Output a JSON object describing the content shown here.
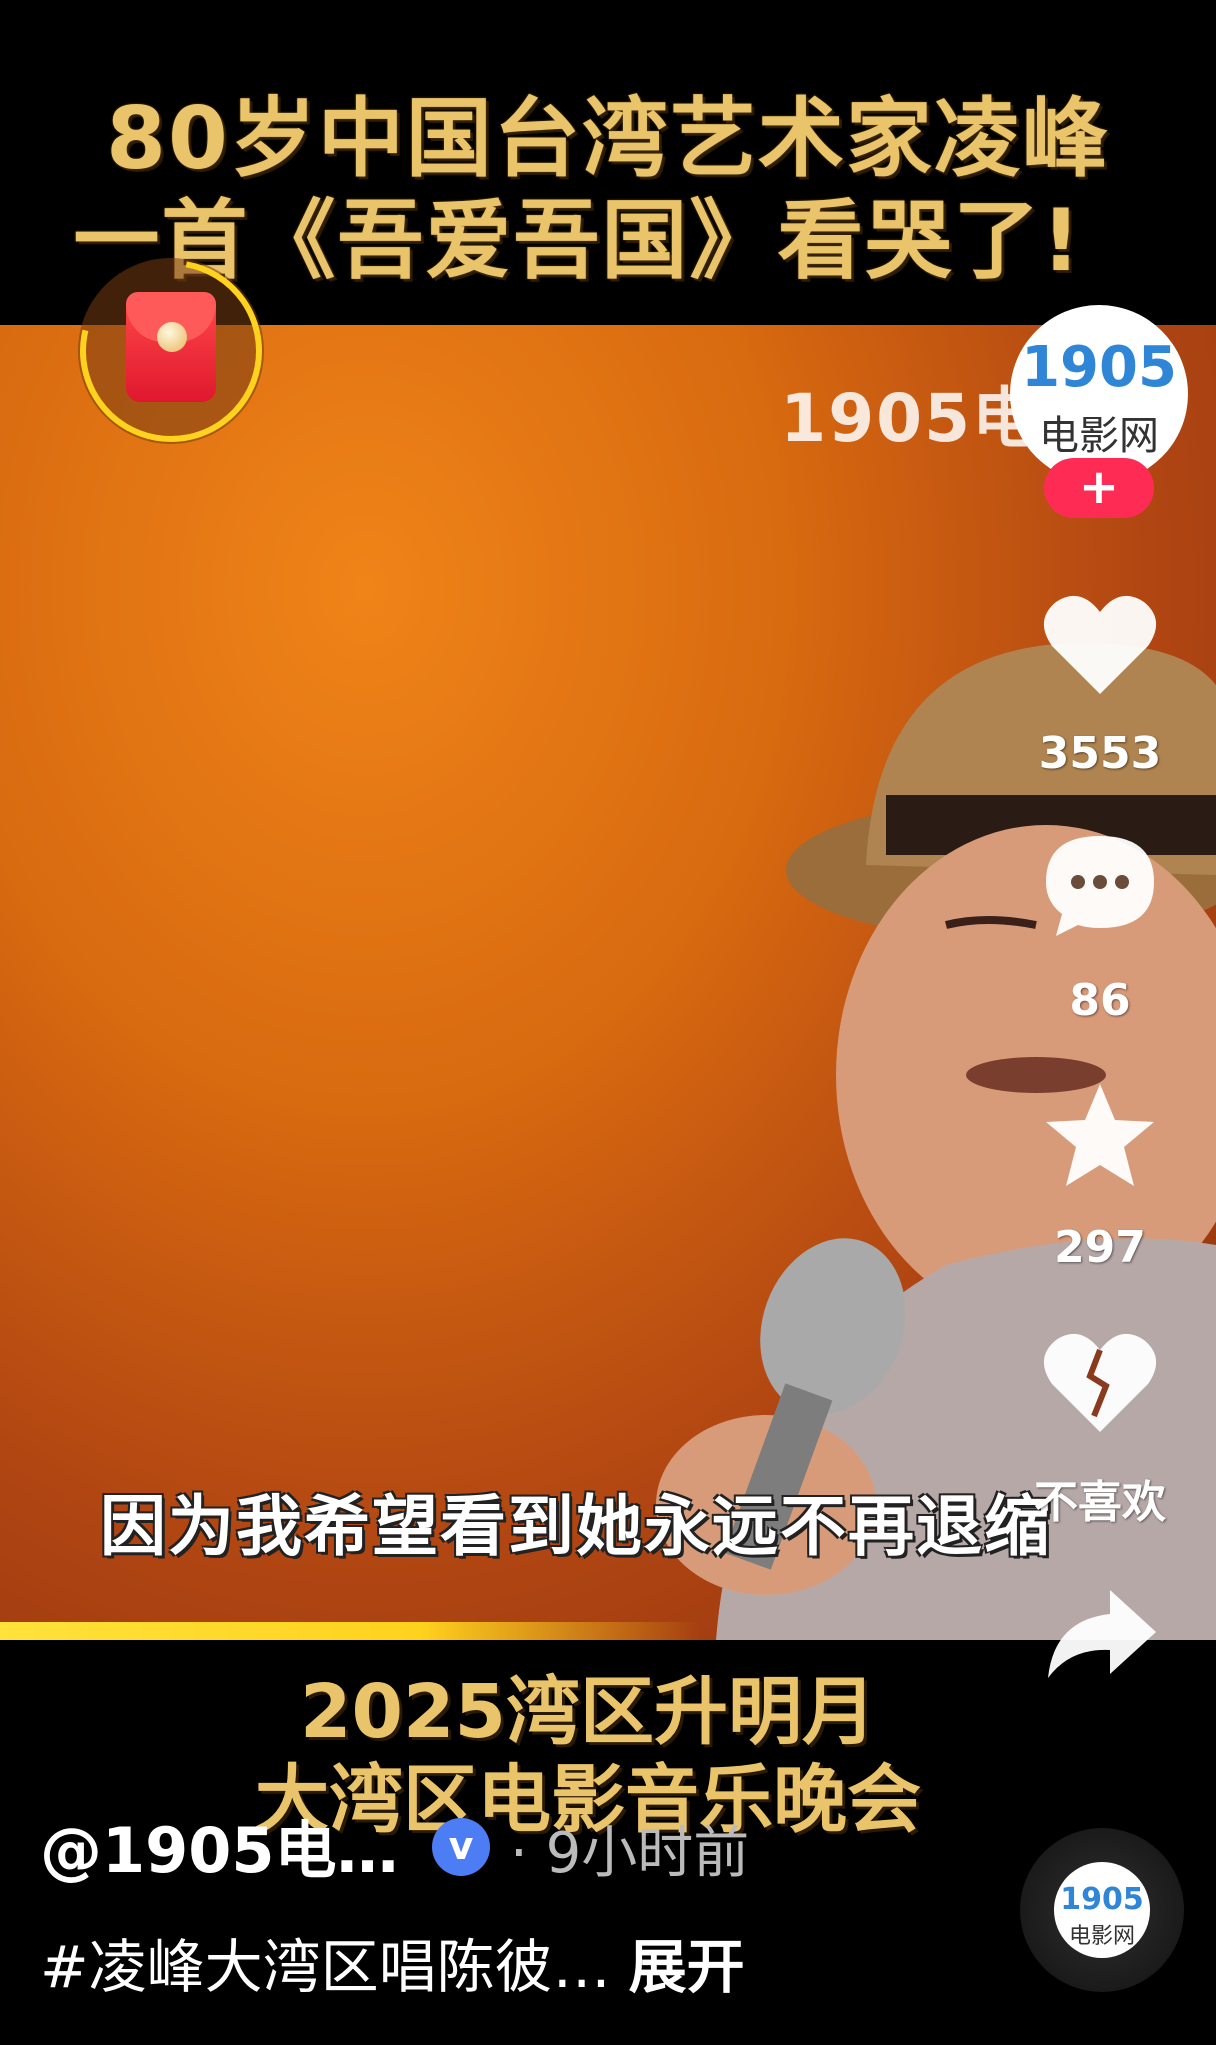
{
  "title": {
    "line1": "80岁中国台湾艺术家凌峰",
    "line2": "一首《吾爱吾国》看哭了!"
  },
  "video": {
    "watermark": "1905电影网",
    "subtitle": "因为我希望看到她永远不再退缩"
  },
  "caption": {
    "line1": "2025湾区升明月",
    "line2": "大湾区电影音乐晚会"
  },
  "creator": {
    "avatar_top": "1905",
    "avatar_bottom": "电影网",
    "follow_label": "+"
  },
  "actions": {
    "like_count": "3553",
    "comment_count": "86",
    "favorite_count": "297",
    "dislike_label": "不喜欢",
    "share_label": ""
  },
  "post": {
    "author": "@1905电…",
    "verified_label": "v",
    "time": "· 9小时前",
    "description": "#凌峰大湾区唱陈彼…",
    "expand_label": "展开"
  },
  "music": {
    "disc_top": "1905",
    "disc_bottom": "电影网"
  },
  "colors": {
    "title_gold": "#e9c46a",
    "follow_red": "#fe2c55",
    "verified_blue": "#4d7df5",
    "brand_blue": "#2f86d6"
  }
}
